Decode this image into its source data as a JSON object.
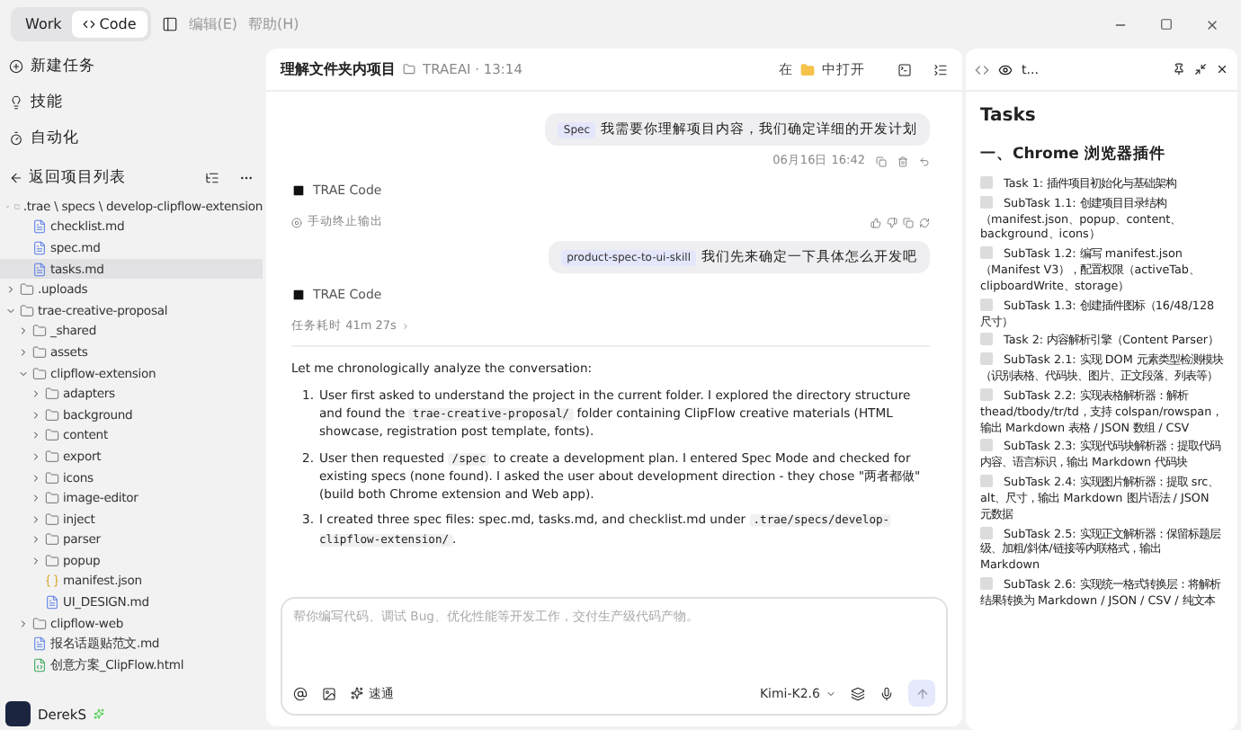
{
  "menu": {
    "modes": [
      {
        "label": "Work",
        "selected": false
      },
      {
        "label": "Code",
        "selected": true
      }
    ],
    "items": [
      "编辑(E)",
      "帮助(H)"
    ]
  },
  "sidebar": {
    "actions": [
      "新建任务",
      "技能",
      "自动化"
    ],
    "back": "返回项目列表",
    "tree": [
      {
        "name": ".trae \\ specs \\ develop-clipflow-extension",
        "kind": "folder",
        "expanded": true,
        "selected": false,
        "children": [
          {
            "name": "checklist.md",
            "kind": "md",
            "selected": false
          },
          {
            "name": "spec.md",
            "kind": "md",
            "selected": false
          },
          {
            "name": "tasks.md",
            "kind": "md",
            "selected": true
          }
        ]
      },
      {
        "name": ".uploads",
        "kind": "folder",
        "expanded": false,
        "selected": false
      },
      {
        "name": "trae-creative-proposal",
        "kind": "folder",
        "expanded": true,
        "selected": false,
        "children": [
          {
            "name": "_shared",
            "kind": "folder",
            "expanded": false,
            "selected": false
          },
          {
            "name": "assets",
            "kind": "folder",
            "expanded": false,
            "selected": false
          },
          {
            "name": "clipflow-extension",
            "kind": "folder",
            "expanded": true,
            "selected": false,
            "children": [
              {
                "name": "adapters",
                "kind": "folder",
                "expanded": false,
                "selected": false
              },
              {
                "name": "background",
                "kind": "folder",
                "expanded": false,
                "selected": false
              },
              {
                "name": "content",
                "kind": "folder",
                "expanded": false,
                "selected": false
              },
              {
                "name": "export",
                "kind": "folder",
                "expanded": false,
                "selected": false
              },
              {
                "name": "icons",
                "kind": "folder",
                "expanded": false,
                "selected": false
              },
              {
                "name": "image-editor",
                "kind": "folder",
                "expanded": false,
                "selected": false
              },
              {
                "name": "inject",
                "kind": "folder",
                "expanded": false,
                "selected": false
              },
              {
                "name": "parser",
                "kind": "folder",
                "expanded": false,
                "selected": false
              },
              {
                "name": "popup",
                "kind": "folder",
                "expanded": false,
                "selected": false
              },
              {
                "name": "manifest.json",
                "kind": "json",
                "selected": false
              },
              {
                "name": "UI_DESIGN.md",
                "kind": "md",
                "selected": false
              }
            ]
          },
          {
            "name": "clipflow-web",
            "kind": "folder",
            "expanded": false,
            "selected": false
          },
          {
            "name": "报名话题贴范文.md",
            "kind": "md",
            "selected": false
          },
          {
            "name": "创意方案_ClipFlow.html",
            "kind": "html",
            "selected": false
          }
        ]
      }
    ],
    "user": "DerekS"
  },
  "chat": {
    "title": "理解文件夹内项目",
    "project": "TRAEAI · 13:14",
    "open_prefix": "在",
    "open_suffix": "中打开",
    "messages": [
      {
        "kind": "user",
        "tag": "Spec",
        "text": "我需要你理解项目内容，我们确定详细的开发计划",
        "time": "06月16日 16:42"
      },
      {
        "kind": "assistant",
        "author": "TRAE Code",
        "status": "手动终止输出"
      },
      {
        "kind": "user",
        "tag": "product-spec-to-ui-skill",
        "text": "我们先来确定一下具体怎么开发吧"
      },
      {
        "kind": "assistant",
        "author": "TRAE Code",
        "status": "任务耗时 41m 27s",
        "intro": "Let me chronologically analyze the conversation:",
        "list": [
          {
            "number": "1.",
            "parts": [
              {
                "kind": "text",
                "text": "User first asked to understand the project in the current folder. I explored the directory structure and found the "
              },
              {
                "kind": "code",
                "text": "trae-creative-proposal/"
              },
              {
                "kind": "text",
                "text": " folder containing ClipFlow creative materials (HTML showcase, registration post template, fonts)."
              }
            ]
          },
          {
            "number": "2.",
            "parts": [
              {
                "kind": "text",
                "text": "User then requested "
              },
              {
                "kind": "code",
                "text": "/spec"
              },
              {
                "kind": "text",
                "text": " to create a development plan. I entered Spec Mode and checked for existing specs (none found). I asked the user about development direction - they chose \"两者都做\" (build both Chrome extension and Web app)."
              }
            ]
          },
          {
            "number": "3.",
            "parts": [
              {
                "kind": "text",
                "text": "I created three spec files: spec.md, tasks.md, and checklist.md under "
              },
              {
                "kind": "code",
                "text": ".trae/specs/develop-clipflow-extension/"
              },
              {
                "kind": "text",
                "text": "."
              }
            ]
          }
        ]
      }
    ],
    "input": {
      "placeholder": "帮你编写代码、调试 Bug、优化性能等开发工作，交付生产级代码产物。",
      "mode": "速通",
      "model": "Kimi-K2.6"
    }
  },
  "panel": {
    "tab": "t...",
    "heading": "Tasks",
    "section": "一、Chrome 浏览器插件",
    "tasks": [
      {
        "text": "Task 1: 插件项目初始化与基础架构",
        "checked": false
      },
      {
        "text": "SubTask 1.1: 创建项目目录结构（manifest.json、popup、content、background、icons）",
        "checked": false
      },
      {
        "text": "SubTask 1.2: 编写 manifest.json（Manifest V3），配置权限（activeTab、clipboardWrite、storage）",
        "checked": false
      },
      {
        "text": "SubTask 1.3: 创建插件图标（16/48/128 尺寸）",
        "checked": false
      },
      {
        "text": "Task 2: 内容解析引擎（Content Parser）",
        "checked": false
      },
      {
        "text": "SubTask 2.1: 实现 DOM 元素类型检测模块（识别表格、代码块、图片、正文段落、列表等）",
        "checked": false
      },
      {
        "text": "SubTask 2.2: 实现表格解析器：解析 thead/tbody/tr/td，支持 colspan/rowspan，输出 Markdown 表格 / JSON 数组 / CSV",
        "checked": false
      },
      {
        "text": "SubTask 2.3: 实现代码块解析器：提取代码内容、语言标识，输出 Markdown 代码块",
        "checked": false
      },
      {
        "text": "SubTask 2.4: 实现图片解析器：提取 src、alt、尺寸，输出 Markdown 图片语法 / JSON 元数据",
        "checked": false
      },
      {
        "text": "SubTask 2.5: 实现正文解析器：保留标题层级、加粗/斜体/链接等内联格式，输出 Markdown",
        "checked": false
      },
      {
        "text": "SubTask 2.6: 实现统一格式转换层：将解析结果转换为 Markdown / JSON / CSV / 纯文本",
        "checked": false
      }
    ]
  }
}
